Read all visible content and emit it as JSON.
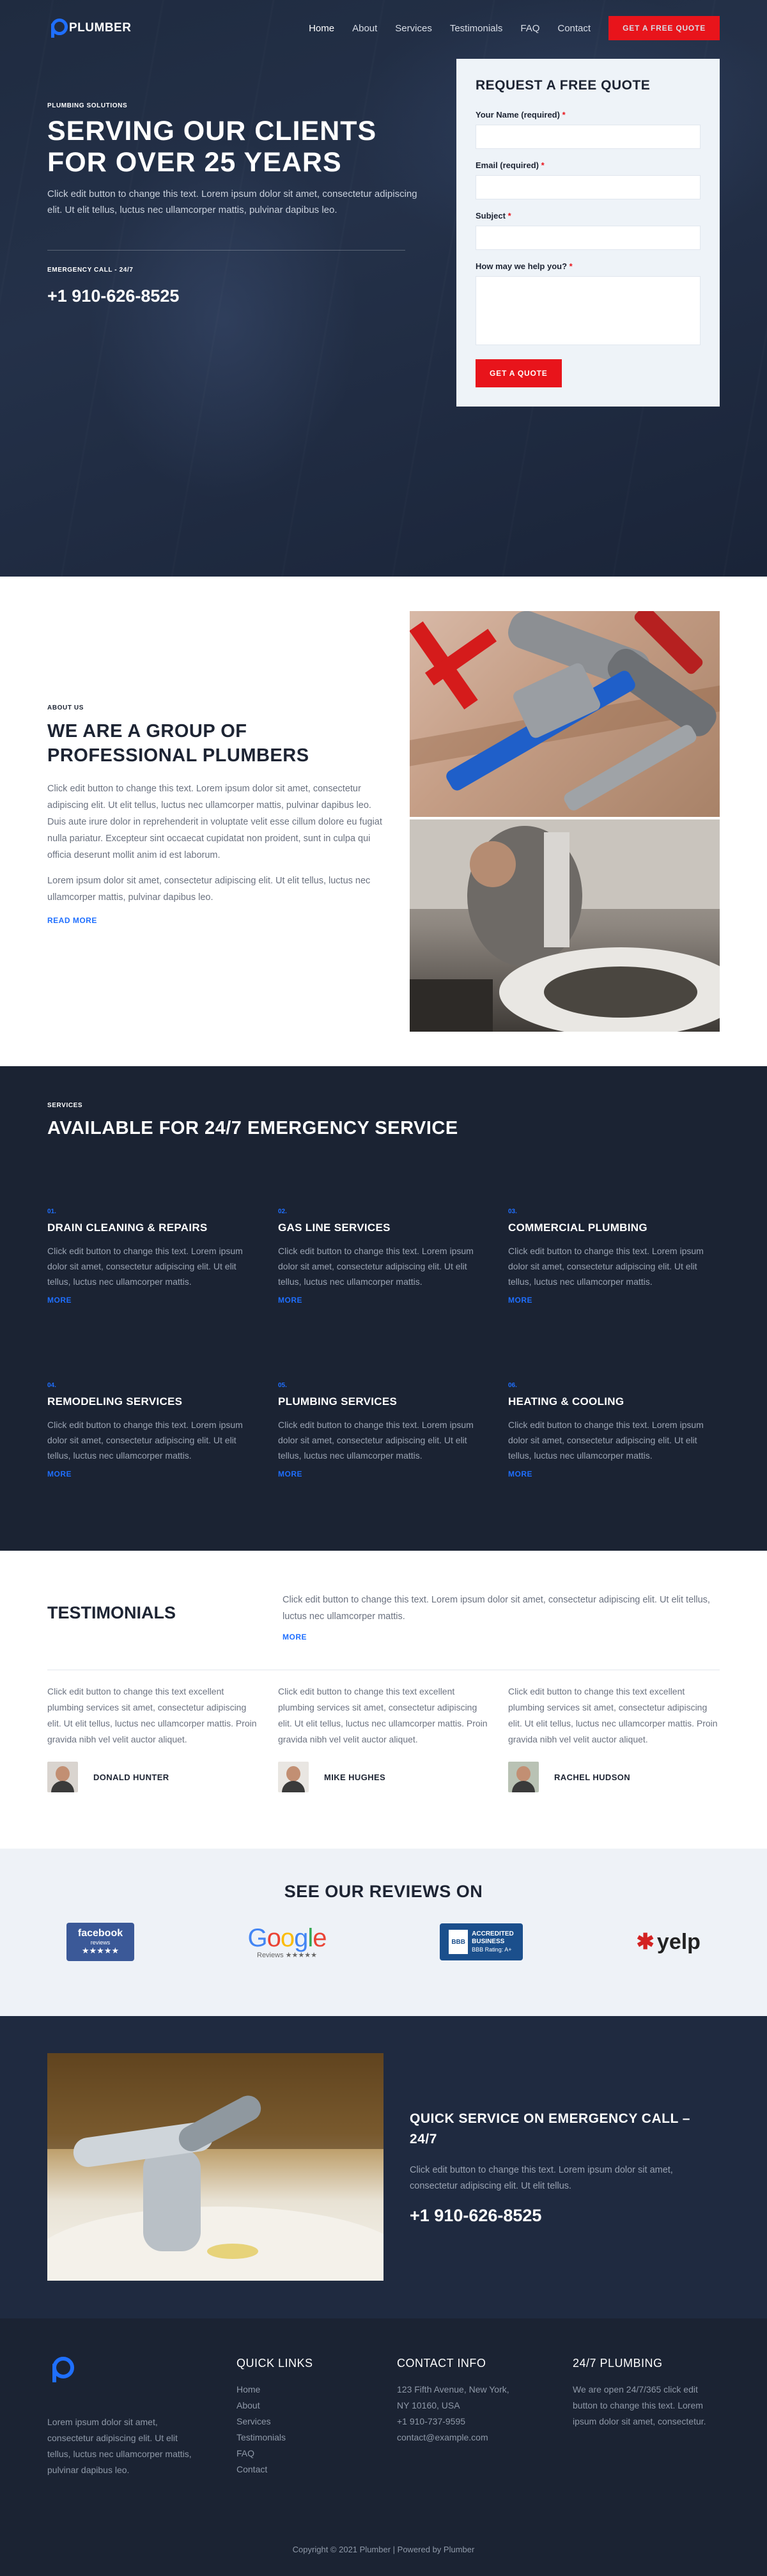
{
  "brand": {
    "name": "PLUMBER"
  },
  "nav": {
    "items": [
      "Home",
      "About",
      "Services",
      "Testimonials",
      "FAQ",
      "Contact"
    ],
    "cta": "GET A FREE QUOTE"
  },
  "hero": {
    "eyebrow": "PLUMBING SOLUTIONS",
    "title": "SERVING OUR CLIENTS FOR OVER 25 YEARS",
    "text": "Click edit button to change this text. Lorem ipsum dolor sit amet, consectetur adipiscing elit. Ut elit tellus, luctus nec ullamcorper mattis, pulvinar dapibus leo.",
    "emergency_label": "EMERGENCY CALL - 24/7",
    "phone": "+1 910-626-8525"
  },
  "quote_form": {
    "title": "REQUEST A FREE QUOTE",
    "name_label": "Your Name (required)",
    "email_label": "Email (required)",
    "subject_label": "Subject",
    "message_label": "How may we help you?",
    "required_mark": "*",
    "submit": "GET A QUOTE"
  },
  "about": {
    "eyebrow": "ABOUT US",
    "title": "WE ARE A GROUP OF PROFESSIONAL PLUMBERS",
    "p1": "Click edit button to change this text. Lorem ipsum dolor sit amet, consectetur adipiscing elit. Ut elit tellus, luctus nec ullamcorper mattis, pulvinar dapibus leo. Duis aute irure dolor in reprehenderit in voluptate velit esse cillum dolore eu fugiat nulla pariatur. Excepteur sint occaecat cupidatat non proident, sunt in culpa qui officia deserunt mollit anim id est laborum.",
    "p2": "Lorem ipsum dolor sit amet, consectetur adipiscing elit. Ut elit tellus, luctus nec ullamcorper mattis, pulvinar dapibus leo.",
    "more": "READ MORE"
  },
  "services": {
    "eyebrow": "SERVICES",
    "title": "AVAILABLE FOR 24/7 EMERGENCY SERVICE",
    "more": "MORE",
    "items": [
      {
        "num": "01.",
        "title": "DRAIN CLEANING & REPAIRS",
        "text": "Click edit button to change this text. Lorem ipsum dolor sit amet, consectetur adipiscing elit. Ut elit tellus, luctus nec ullamcorper mattis."
      },
      {
        "num": "02.",
        "title": "GAS LINE SERVICES",
        "text": "Click edit button to change this text. Lorem ipsum dolor sit amet, consectetur adipiscing elit. Ut elit tellus, luctus nec ullamcorper mattis."
      },
      {
        "num": "03.",
        "title": "COMMERCIAL PLUMBING",
        "text": "Click edit button to change this text. Lorem ipsum dolor sit amet, consectetur adipiscing elit. Ut elit tellus, luctus nec ullamcorper mattis."
      },
      {
        "num": "04.",
        "title": "REMODELING SERVICES",
        "text": "Click edit button to change this text. Lorem ipsum dolor sit amet, consectetur adipiscing elit. Ut elit tellus, luctus nec ullamcorper mattis."
      },
      {
        "num": "05.",
        "title": "PLUMBING SERVICES",
        "text": "Click edit button to change this text. Lorem ipsum dolor sit amet, consectetur adipiscing elit. Ut elit tellus, luctus nec ullamcorper mattis."
      },
      {
        "num": "06.",
        "title": "HEATING & COOLING",
        "text": "Click edit button to change this text. Lorem ipsum dolor sit amet, consectetur adipiscing elit. Ut elit tellus, luctus nec ullamcorper mattis."
      }
    ]
  },
  "testimonials": {
    "title": "TESTIMONIALS",
    "intro": "Click edit button to change this text. Lorem ipsum dolor sit amet, consectetur adipiscing elit. Ut elit tellus, luctus nec ullamcorper mattis.",
    "more": "MORE",
    "items": [
      {
        "text": "Click edit button to change this text excellent plumbing services sit amet, consectetur adipiscing elit. Ut elit tellus, luctus nec ullamcorper mattis. Proin gravida nibh vel velit auctor aliquet.",
        "name": "DONALD HUNTER"
      },
      {
        "text": "Click edit button to change this text excellent plumbing services sit amet, consectetur adipiscing elit. Ut elit tellus, luctus nec ullamcorper mattis. Proin gravida nibh vel velit auctor aliquet.",
        "name": "MIKE HUGHES"
      },
      {
        "text": "Click edit button to change this text excellent plumbing services sit amet, consectetur adipiscing elit. Ut elit tellus, luctus nec ullamcorper mattis. Proin gravida nibh vel velit auctor aliquet.",
        "name": "RACHEL HUDSON"
      }
    ]
  },
  "reviews": {
    "title": "SEE OUR REVIEWS ON",
    "facebook": {
      "name": "facebook",
      "sub": "reviews",
      "stars": "★★★★★"
    },
    "google": {
      "name": "Google",
      "sub": "Reviews ★★★★★"
    },
    "bbb": {
      "logo": "BBB",
      "line1": "ACCREDITED",
      "line2": "BUSINESS",
      "rating": "BBB Rating: A+"
    },
    "yelp": {
      "name": "yelp"
    }
  },
  "emergency": {
    "title": "QUICK SERVICE ON EMERGENCY CALL – 24/7",
    "text": "Click edit button to change this text. Lorem ipsum dolor sit amet, consectetur adipiscing elit. Ut elit tellus.",
    "phone": "+1 910-626-8525"
  },
  "footer": {
    "about": "Lorem ipsum dolor sit amet, consectetur adipiscing elit. Ut elit tellus, luctus nec ullamcorper mattis, pulvinar dapibus leo.",
    "links_title": "QUICK LINKS",
    "links": [
      "Home",
      "About",
      "Services",
      "Testimonials",
      "FAQ",
      "Contact"
    ],
    "contact_title": "CONTACT INFO",
    "contact": [
      "123 Fifth Avenue, New York,",
      "NY 10160, USA",
      "+1 910-737-9595",
      "contact@example.com"
    ],
    "plumbing_title": "24/7 PLUMBING",
    "plumbing_text": "We are open 24/7/365 click edit button to change this text. Lorem ipsum dolor sit amet, consectetur.",
    "copyright": "Copyright © 2021 Plumber | Powered by Plumber"
  },
  "colors": {
    "accent": "#1f6fff",
    "cta": "#e8141b",
    "dark": "#1b2333"
  }
}
